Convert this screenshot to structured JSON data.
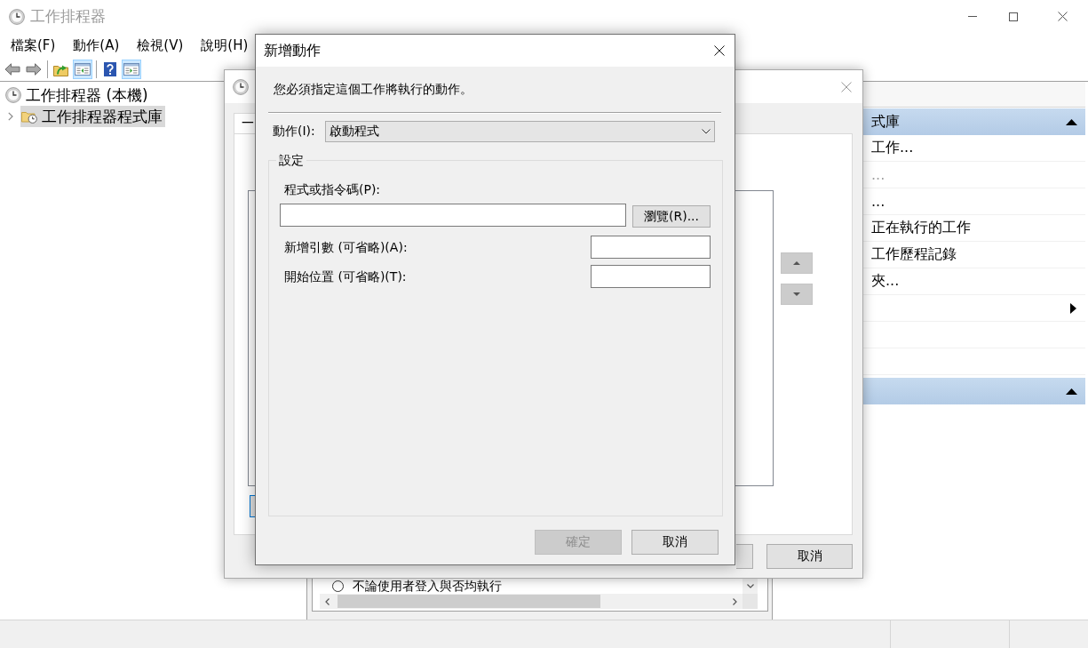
{
  "window": {
    "title": "工作排程器"
  },
  "menu": [
    "檔案(F)",
    "動作(A)",
    "檢視(V)",
    "說明(H)"
  ],
  "toolbar": {
    "groups": [
      {
        "buttons": [
          {
            "kind": "back",
            "on": false
          },
          {
            "kind": "forward",
            "on": false
          }
        ]
      },
      {
        "buttons": [
          {
            "kind": "up",
            "on": false
          },
          {
            "kind": "tree_pane",
            "on": true
          }
        ]
      },
      {
        "buttons": [
          {
            "kind": "help",
            "on": false
          },
          {
            "kind": "action_pane",
            "on": true
          }
        ]
      }
    ]
  },
  "tree": [
    {
      "label": "工作排程器 (本機)",
      "kind": "computer",
      "selected": false,
      "children": [
        {
          "label": "工作排程器程式庫",
          "kind": "folder",
          "selected": true,
          "expanded": false
        }
      ]
    }
  ],
  "center_pane": {
    "option": {
      "label": "不論使用者登入與否均執行",
      "selected": false
    }
  },
  "actions_pane": {
    "sections": [
      {
        "title": "式庫",
        "expanded": true,
        "items": [
          {
            "kind": "command",
            "label": "工作...",
            "disabled": false
          },
          {
            "kind": "command",
            "label": "...",
            "disabled": true
          },
          {
            "kind": "command",
            "label": "...",
            "disabled": false
          },
          {
            "kind": "command",
            "label": "正在執行的工作",
            "disabled": false
          },
          {
            "kind": "command",
            "label": "工作歷程記錄",
            "disabled": false
          },
          {
            "kind": "command",
            "label": "夾...",
            "disabled": false
          },
          {
            "kind": "submenu",
            "disabled": false
          },
          {
            "kind": "command"
          },
          {
            "kind": "command"
          }
        ]
      },
      {
        "expanded": true
      }
    ]
  },
  "task_dialog": {
    "tabs": [
      {
        "label": "一",
        "selected": true
      }
    ],
    "buttons": [
      {
        "label": "取消"
      }
    ]
  },
  "add_action_dialog": {
    "title": "新增動作",
    "prompt": "您必須指定這個工作將執行的動作。",
    "action_label": "動作(I):",
    "action_value": "啟動程式",
    "settings": {
      "title": "設定",
      "fields": [
        {
          "kind": "wide",
          "label": "程式或指令碼(P):",
          "button": "瀏覽(R)..."
        },
        {
          "kind": "inline",
          "label": "新增引數 (可省略)(A):"
        },
        {
          "kind": "inline",
          "label": "開始位置 (可省略)(T):"
        }
      ]
    },
    "buttons": [
      {
        "label": "確定",
        "disabled": true
      },
      {
        "label": "取消",
        "disabled": false
      }
    ]
  }
}
